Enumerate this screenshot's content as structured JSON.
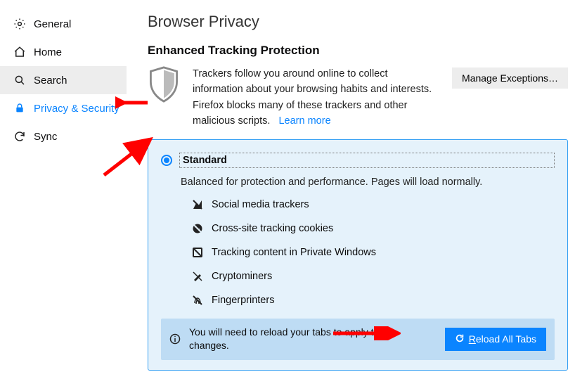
{
  "sidebar": {
    "items": [
      {
        "label": "General"
      },
      {
        "label": "Home"
      },
      {
        "label": "Search"
      },
      {
        "label": "Privacy & Security"
      },
      {
        "label": "Sync"
      }
    ]
  },
  "page": {
    "title": "Browser Privacy",
    "section_title": "Enhanced Tracking Protection",
    "intro": "Trackers follow you around online to collect information about your browsing habits and interests. Firefox blocks many of these trackers and other malicious scripts.",
    "learn_more": "Learn more",
    "manage_exceptions": "Manage Exceptions…"
  },
  "panel": {
    "option_label": "Standard",
    "subtext": "Balanced for protection and performance. Pages will load normally.",
    "features": [
      "Social media trackers",
      "Cross-site tracking cookies",
      "Tracking content in Private Windows",
      "Cryptominers",
      "Fingerprinters"
    ],
    "reload_msg": "You will need to reload your tabs to apply these changes.",
    "reload_btn_prefix": "R",
    "reload_btn_rest": "eload All Tabs"
  }
}
